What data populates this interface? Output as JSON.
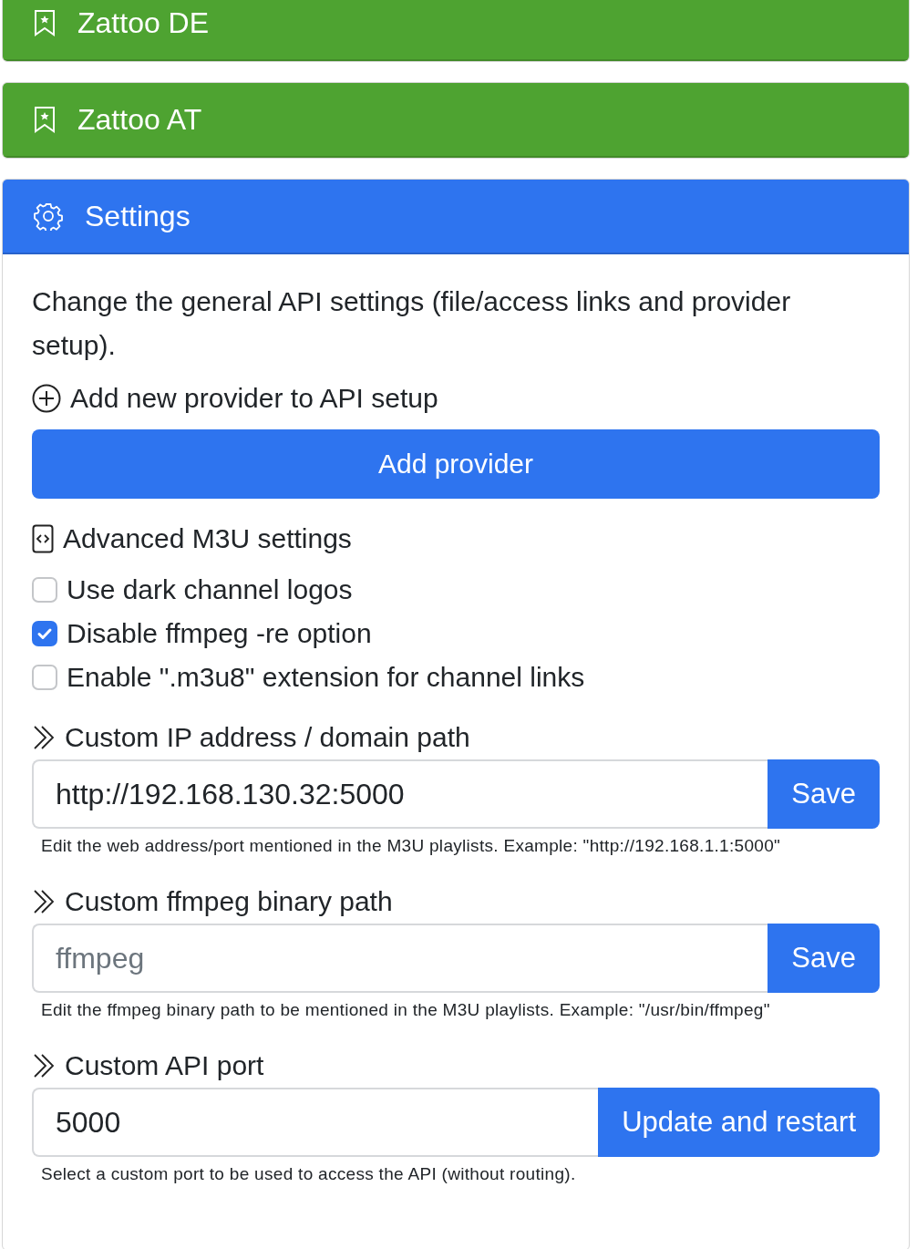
{
  "providers": [
    {
      "title": "Zattoo DE"
    },
    {
      "title": "Zattoo AT"
    }
  ],
  "settings": {
    "title": "Settings",
    "description": "Change the general API settings (file/access links and provider setup).",
    "add_section": {
      "heading": "Add new provider to API setup",
      "button": "Add provider"
    },
    "advanced_heading": "Advanced M3U settings",
    "options": [
      {
        "label": "Use dark channel logos",
        "checked": false
      },
      {
        "label": "Disable ffmpeg -re option",
        "checked": true
      },
      {
        "label": "Enable \".m3u8\" extension for channel links",
        "checked": false
      }
    ],
    "fields": [
      {
        "label": "Custom IP address / domain path",
        "value": "http://192.168.130.32:5000",
        "button": "Save",
        "help": "Edit the web address/port mentioned in the M3U playlists. Example: \"http://192.168.1.1:5000\""
      },
      {
        "label": "Custom ffmpeg binary path",
        "placeholder": "ffmpeg",
        "button": "Save",
        "help": "Edit the ffmpeg binary path to be mentioned in the M3U playlists. Example: \"/usr/bin/ffmpeg\""
      },
      {
        "label": "Custom API port",
        "value": "5000",
        "button": "Update and restart",
        "help": "Select a custom port to be used to access the API (without routing)."
      }
    ]
  }
}
